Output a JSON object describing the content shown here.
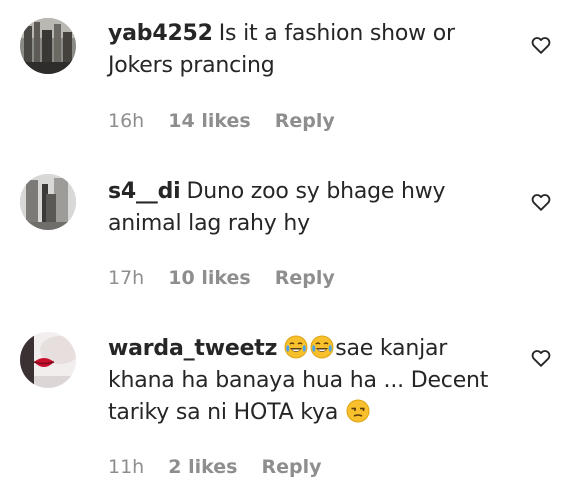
{
  "comments": [
    {
      "username": "yab4252",
      "text_line1": "Is it a fashion show or",
      "text_line2": "Jokers prancing",
      "time": "16h",
      "likes": "14 likes",
      "reply": "Reply",
      "avatar_icon": "city-photo-avatar",
      "like_icon": "heart-outline-icon"
    },
    {
      "username": "s4__di",
      "text_line1": "Duno zoo sy bhage hwy",
      "text_line2": "animal lag rahy hy",
      "time": "17h",
      "likes": "10 likes",
      "reply": "Reply",
      "avatar_icon": "street-photo-avatar",
      "like_icon": "heart-outline-icon"
    },
    {
      "username": "warda_tweetz",
      "text_line1_after_emoji": "sae kanjar",
      "text_line2": "khana ha banaya hua ha ... Decent",
      "text_line3": "tariky sa ni HOTA kya",
      "time": "11h",
      "likes": "2 likes",
      "reply": "Reply",
      "emojis": [
        "face-with-tears-of-joy",
        "face-with-tears-of-joy",
        "unamused-face"
      ],
      "avatar_icon": "red-lips-avatar",
      "like_icon": "heart-outline-icon"
    }
  ],
  "colors": {
    "text": "#262626",
    "meta": "#8e8e8e",
    "background": "#ffffff"
  }
}
